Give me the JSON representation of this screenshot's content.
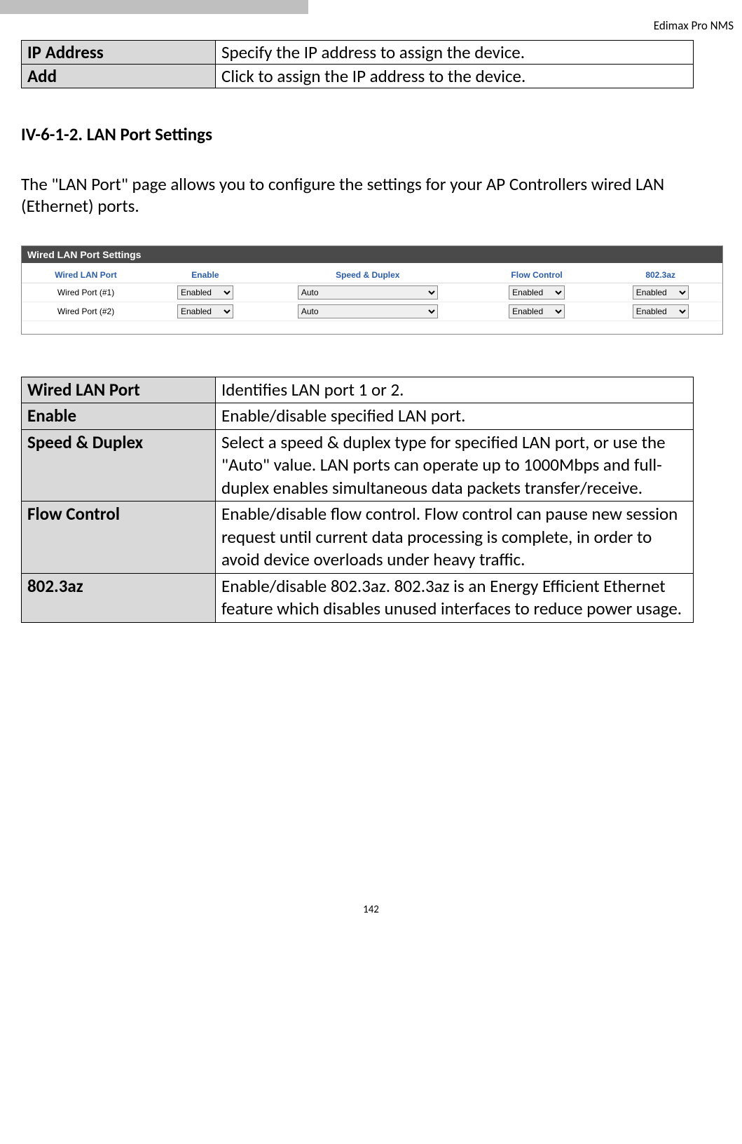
{
  "header": "Edimax Pro NMS",
  "intro_table": {
    "ip_address_label": "IP Address",
    "ip_address_desc": "Specify the IP address to assign the device.",
    "add_label": "Add",
    "add_desc": "Click to assign the IP address to the device."
  },
  "section_heading": "IV-6-1-2.    LAN Port Settings",
  "body_text": "The \"LAN Port\" page allows you to configure the settings for your AP Controllers wired LAN (Ethernet) ports.",
  "ui": {
    "title": "Wired LAN Port Settings",
    "headers": {
      "port": "Wired LAN Port",
      "enable": "Enable",
      "speed": "Speed & Duplex",
      "flow": "Flow Control",
      "az": "802.3az"
    },
    "rows": [
      {
        "port": "Wired Port (#1)",
        "enable": "Enabled",
        "speed": "Auto",
        "flow": "Enabled",
        "az": "Enabled"
      },
      {
        "port": "Wired Port (#2)",
        "enable": "Enabled",
        "speed": "Auto",
        "flow": "Enabled",
        "az": "Enabled"
      }
    ]
  },
  "desc_table": {
    "wired_label": "Wired LAN Port",
    "wired_desc": "Identifies LAN port 1 or 2.",
    "enable_label": "Enable",
    "enable_desc": "Enable/disable specified LAN port.",
    "speed_label": "Speed & Duplex",
    "speed_desc": "Select a speed & duplex type for specified LAN port, or use the \"Auto\" value. LAN ports can operate up to 1000Mbps and full-duplex enables simultaneous data packets transfer/receive.",
    "flow_label": "Flow Control",
    "flow_desc": "Enable/disable flow control. Flow control can pause new session request until current data processing is complete, in order to avoid device overloads under heavy traffic.",
    "az_label": "802.3az",
    "az_desc": "Enable/disable 802.3az. 802.3az is an Energy Efficient Ethernet feature which disables unused interfaces to reduce power usage."
  },
  "page_number": "142"
}
